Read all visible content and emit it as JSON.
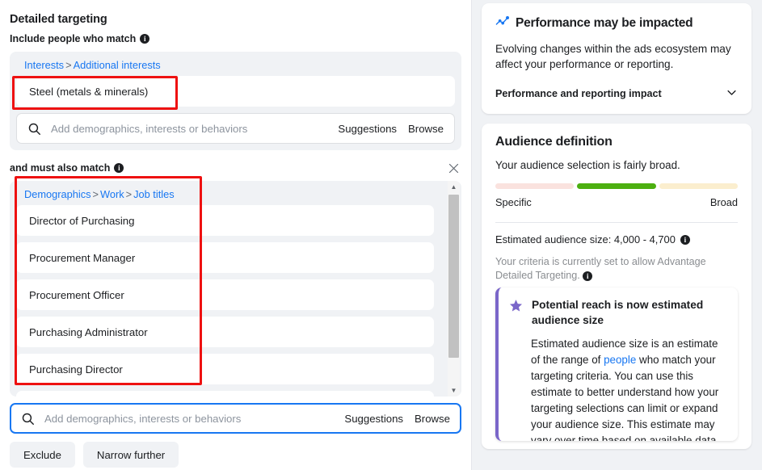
{
  "left": {
    "section_title": "Detailed targeting",
    "include_label": "Include people who match",
    "include_info_icon": "info-icon",
    "interests_breadcrumb": {
      "root": "Interests",
      "separator": ">",
      "leaf": "Additional interests"
    },
    "selected_interest": "Steel (metals & minerals)",
    "search_top": {
      "icon": "search-icon",
      "placeholder": "Add demographics, interests or behaviors",
      "suggestions_label": "Suggestions",
      "browse_label": "Browse"
    },
    "also_match_label": "and must also match",
    "also_match_info_icon": "info-icon",
    "close_icon": "close-icon",
    "jobs_breadcrumb": {
      "root": "Demographics",
      "separator": ">",
      "mid": "Work",
      "leaf": "Job titles"
    },
    "job_titles": [
      "Director of Purchasing",
      "Procurement Manager",
      "Procurement Officer",
      "Purchasing Administrator",
      "Purchasing Director"
    ],
    "scrollbar": {
      "up_icon": "chevron-up-icon",
      "down_icon": "chevron-down-icon"
    },
    "search_bottom": {
      "icon": "search-icon",
      "placeholder": "Add demographics, interests or behaviors",
      "suggestions_label": "Suggestions",
      "browse_label": "Browse"
    },
    "buttons": {
      "exclude": "Exclude",
      "narrow_further": "Narrow further"
    },
    "annotation_color": "#ee1111"
  },
  "right": {
    "performance_card": {
      "icon": "trend-chart-icon",
      "title": "Performance may be impacted",
      "body": "Evolving changes within the ads ecosystem may affect your performance or reporting.",
      "footer_label": "Performance and reporting impact",
      "footer_icon": "chevron-down-icon"
    },
    "audience_card": {
      "title": "Audience definition",
      "subtitle": "Your audience selection is fairly broad.",
      "meter": {
        "segments": [
          "#fae2de",
          "#4caf10",
          "#fbeece"
        ],
        "left_label": "Specific",
        "right_label": "Broad"
      },
      "estimate_label": "Estimated audience size: 4,000 - 4,700",
      "estimate_info_icon": "info-icon",
      "criteria_note": "Your criteria is currently set to allow Advantage Detailed Targeting.",
      "criteria_info_icon": "info-icon"
    },
    "tooltip_card": {
      "icon": "star-icon",
      "accent_color": "#7a66c9",
      "title": "Potential reach is now estimated audience size",
      "body_before_link": "Estimated audience size is an estimate of the range of ",
      "body_link": "people",
      "body_after_link": " who match your targeting criteria. You can use this estimate to better understand how your targeting selections can limit or expand your audience size. This estimate may vary over time based on available data. You"
    }
  }
}
